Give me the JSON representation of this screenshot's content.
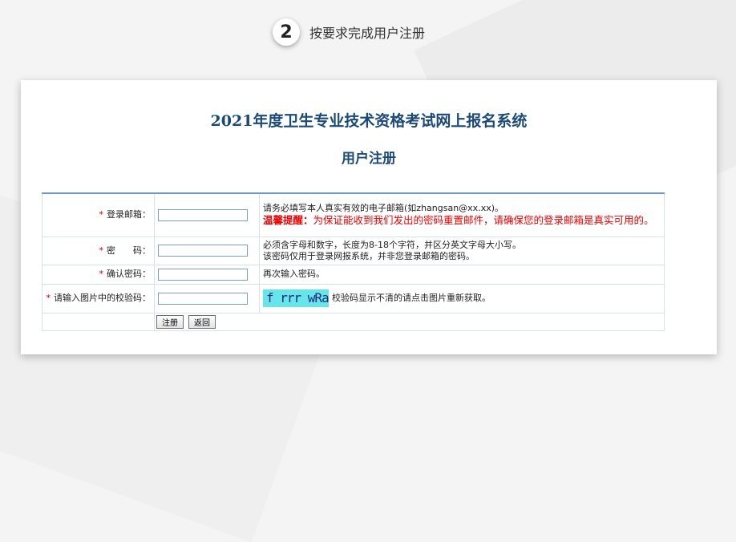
{
  "step": {
    "number": "2",
    "text": "按要求完成用户注册"
  },
  "page": {
    "title": "2021年度卫生专业技术资格考试网上报名系统",
    "subtitle": "用户注册"
  },
  "form": {
    "email": {
      "star": "*",
      "label": "登录邮箱：",
      "value": "",
      "hint": "请务必填写本人真实有效的电子邮箱(如zhangsan@xx.xx)。",
      "warning_prefix": "温馨提醒：",
      "warning": "为保证能收到我们发出的密码重置邮件，请确保您的登录邮箱是真实可用的。"
    },
    "password": {
      "star": "*",
      "label": "密　　码：",
      "value": "",
      "hint1": "必须含字母和数字，长度为8-18个字符，并区分英文字母大小写。",
      "hint2": "该密码仅用于登录网报系统，并非您登录邮箱的密码。"
    },
    "confirm": {
      "star": "*",
      "label": "确认密码：",
      "value": "",
      "hint": "再次输入密码。"
    },
    "captcha": {
      "star": "*",
      "label": "请输入图片中的校验码：",
      "value": "",
      "image_text": "f rrr wRa",
      "hint": "校验码显示不清的请点击图片重新获取。"
    }
  },
  "buttons": {
    "register": "注册",
    "back": "返回"
  }
}
